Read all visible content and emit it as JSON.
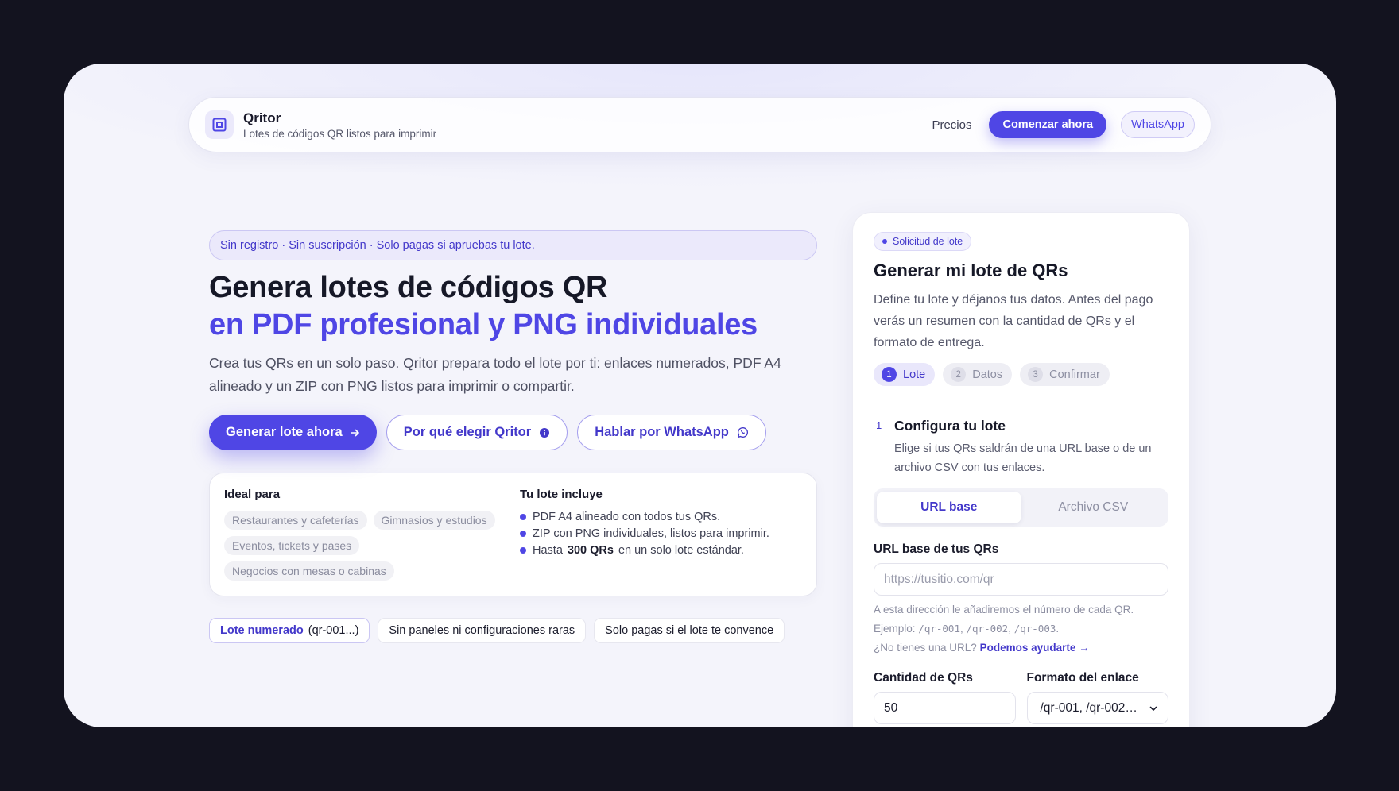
{
  "nav": {
    "brand_name": "Qritor",
    "brand_tagline": "Lotes de códigos QR listos para imprimir",
    "link_pricing": "Precios",
    "cta_start": "Comenzar ahora",
    "cta_whatsapp": "WhatsApp",
    "logo_icon": "qr-frame-icon"
  },
  "hero": {
    "banner": "Sin registro · Sin suscripción · Solo pagas si apruebas tu lote.",
    "title_line1": "Genera lotes de códigos QR",
    "title_line2": "en PDF profesional y PNG individuales",
    "lead": "Crea tus QRs en un solo paso. Qritor prepara todo el lote por ti: enlaces numerados, PDF A4 alineado y un ZIP con PNG listos para imprimir o compartir.",
    "buttons": {
      "generate": "Generar lote ahora",
      "why": "Por qué elegir Qritor",
      "whatsapp": "Hablar por WhatsApp"
    },
    "ideal_title": "Ideal para",
    "ideal_chips": [
      "Restaurantes y cafeterías",
      "Gimnasios y estudios",
      "Eventos, tickets y pases",
      "Negocios con mesas o cabinas"
    ],
    "includes_title": "Tu lote incluye",
    "includes": [
      {
        "text": "PDF A4 alineado con todos tus QRs."
      },
      {
        "text": "ZIP con PNG individuales, listos para imprimir."
      },
      {
        "pre": "Hasta",
        "bold": "300 QRs",
        "post": "en un solo lote estándar."
      }
    ],
    "tags": {
      "numbered_accent": "Lote numerado",
      "numbered_rest": "(qr-001...)",
      "no_panels": "Sin paneles ni configuraciones raras",
      "pay_if": "Solo pagas si el lote te convence"
    }
  },
  "form": {
    "badge": "Solicitud de lote",
    "title": "Generar mi lote de QRs",
    "description": "Define tu lote y déjanos tus datos. Antes del pago verás un resumen con la cantidad de QRs y el formato de entrega.",
    "steps": [
      {
        "num": "1",
        "label": "Lote"
      },
      {
        "num": "2",
        "label": "Datos"
      },
      {
        "num": "3",
        "label": "Confirmar"
      }
    ],
    "section": {
      "num": "1",
      "title": "Configura tu lote",
      "description": "Elige si tus QRs saldrán de una URL base o de un archivo CSV con tus enlaces."
    },
    "segment": {
      "url": "URL base",
      "csv": "Archivo CSV"
    },
    "url_label": "URL base de tus QRs",
    "url_placeholder": "https://tusitio.com/qr",
    "help_prefix": "A esta dirección le añadiremos el número de cada QR. Ejemplo:",
    "help_codes": [
      "/qr-001",
      "/qr-002",
      "/qr-003"
    ],
    "no_url_text": "¿No tienes una URL?",
    "no_url_link": "Podemos ayudarte →",
    "qty_label": "Cantidad de QRs",
    "qty_value": "50",
    "format_label": "Formato del enlace",
    "format_value": "/qr-001, /qr-002…"
  },
  "colors": {
    "accent": "#4f46e5",
    "background": "#13131f",
    "surface": "#f4f4fb"
  }
}
